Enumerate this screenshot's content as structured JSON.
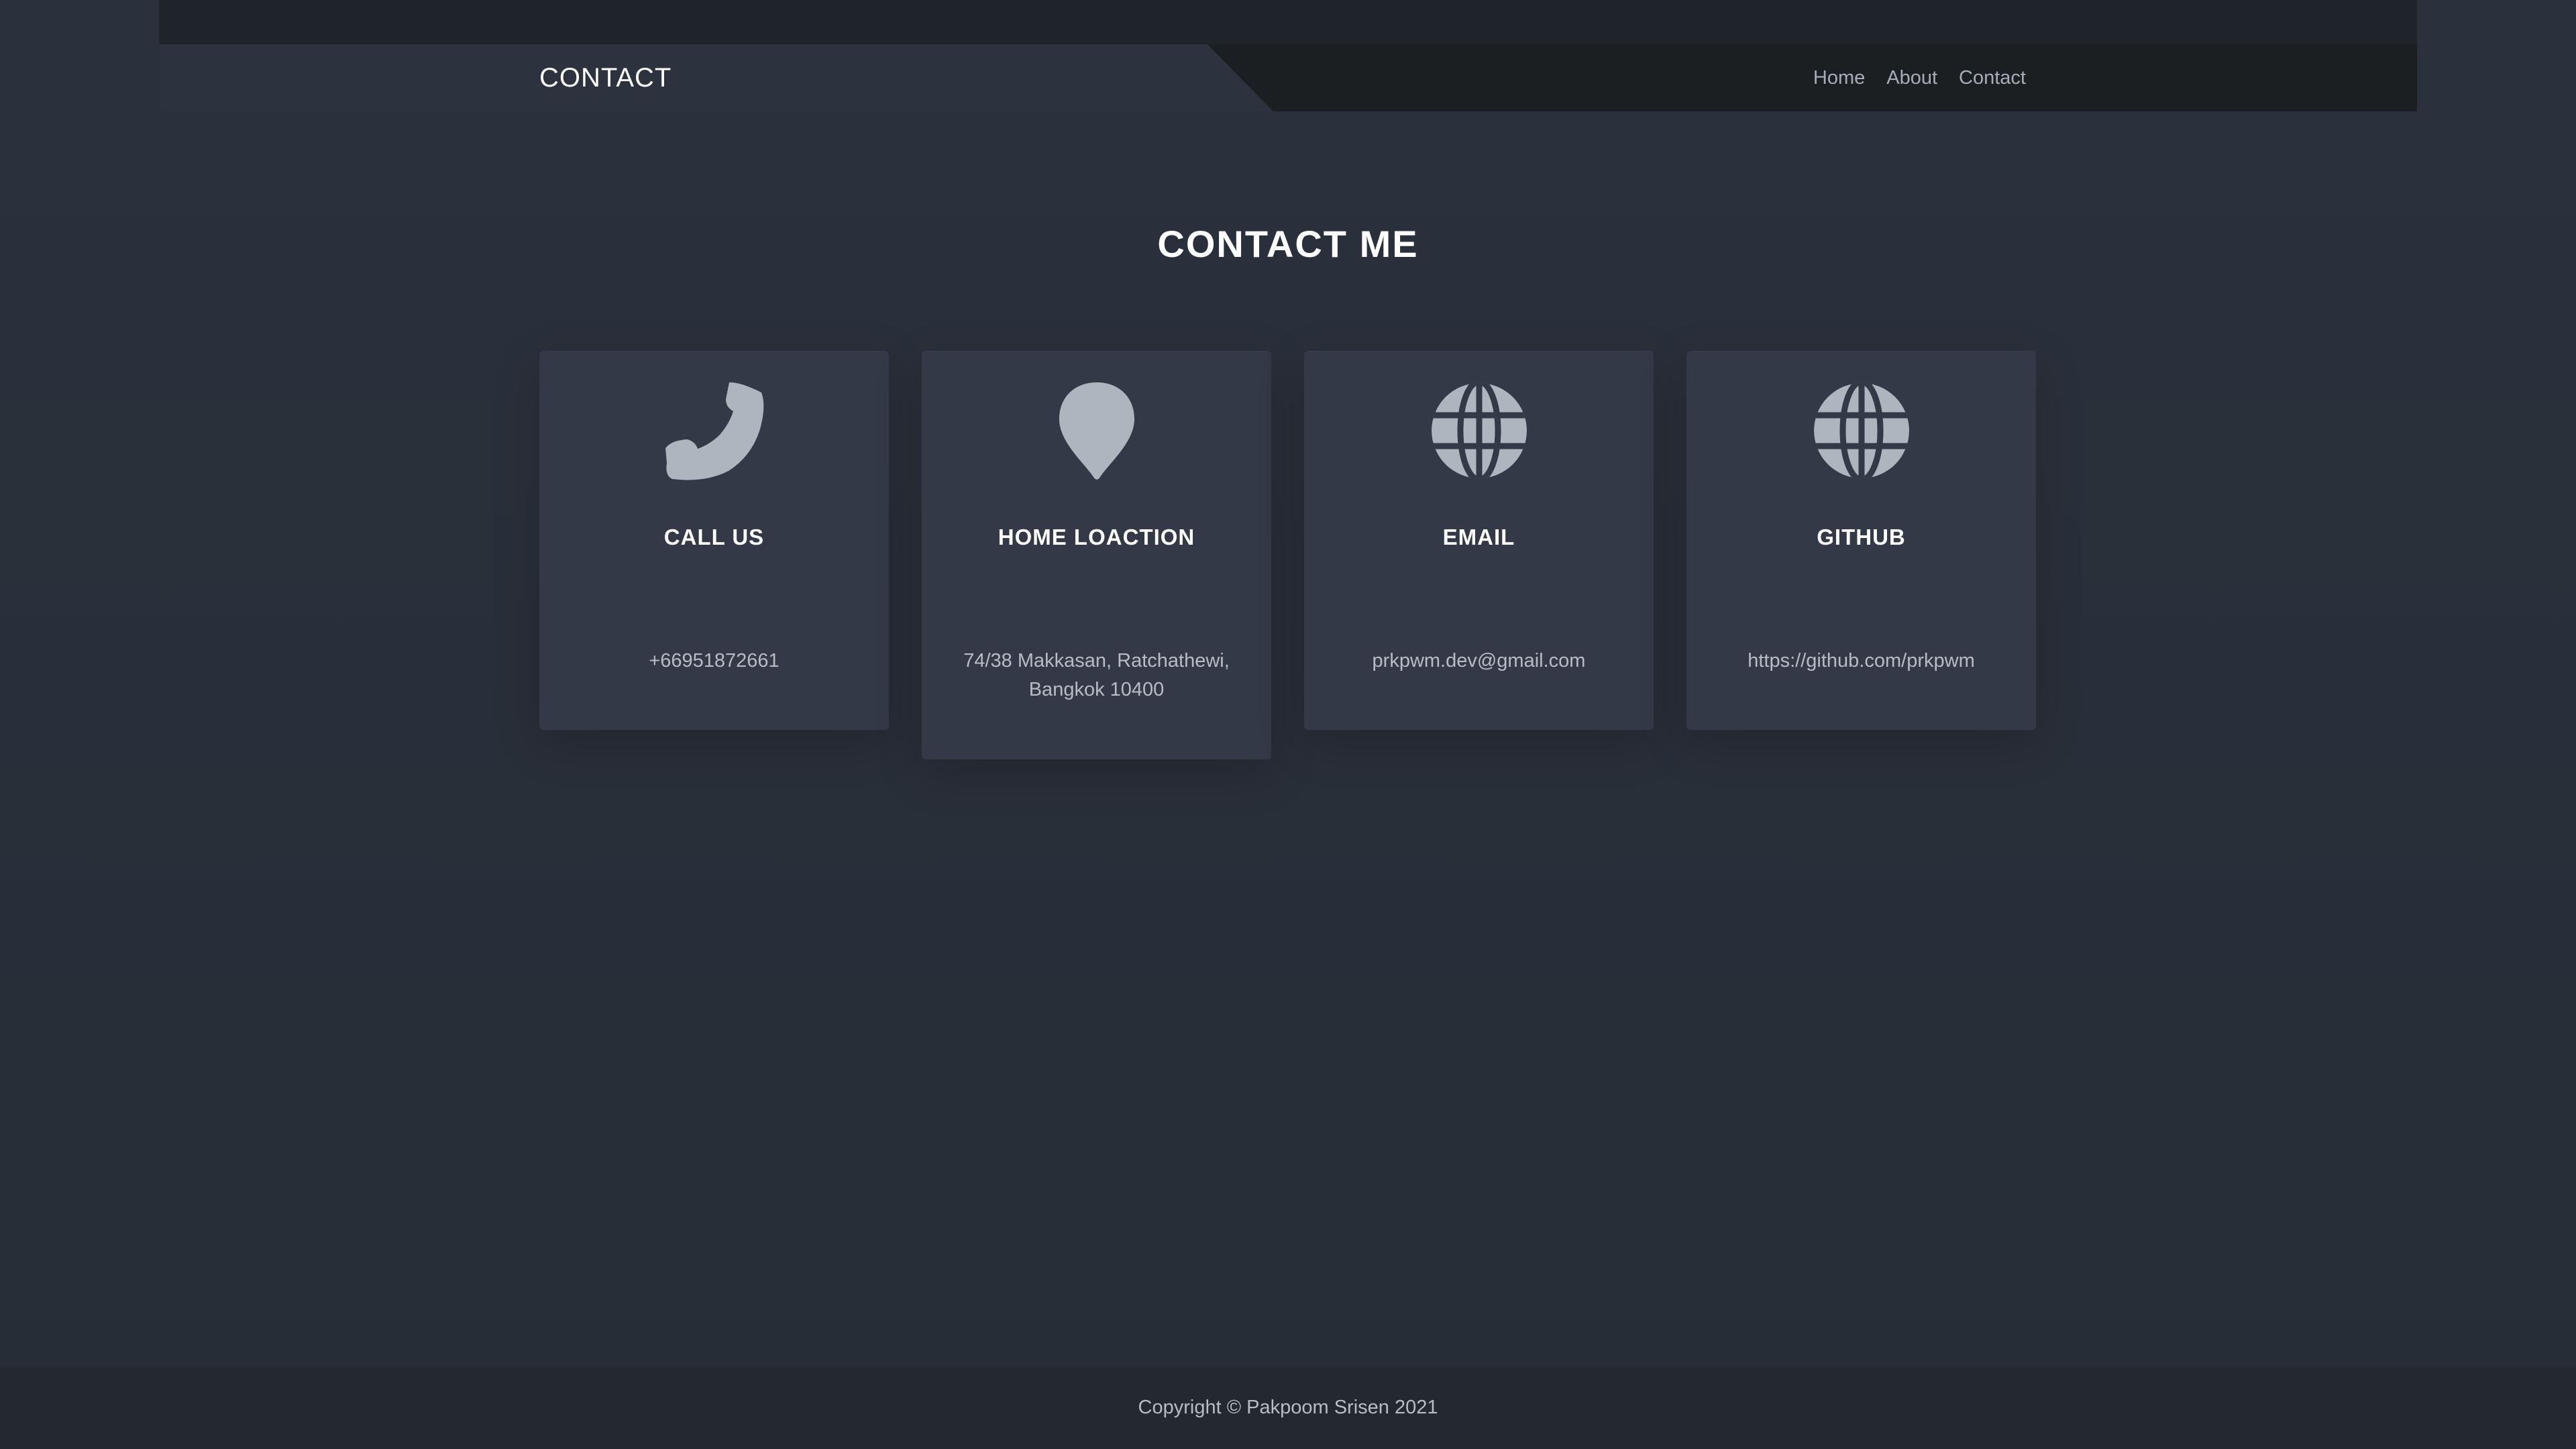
{
  "header": {
    "brand": "CONTACT",
    "nav": {
      "home": "Home",
      "about": "About",
      "contact": "Contact"
    }
  },
  "main": {
    "title": "CONTACT ME",
    "cards": [
      {
        "icon": "phone-icon",
        "title": "CALL US",
        "value": "+66951872661"
      },
      {
        "icon": "map-pin-icon",
        "title": "HOME LOACTION",
        "value": "74/38 Makkasan, Ratchathewi, Bangkok 10400"
      },
      {
        "icon": "globe-icon",
        "title": "EMAIL",
        "value": "prkpwm.dev@gmail.com"
      },
      {
        "icon": "globe-icon",
        "title": "GITHUB",
        "value": "https://github.com/prkpwm"
      }
    ]
  },
  "footer": {
    "copyright": "Copyright © Pakpoom Srisen 2021"
  },
  "colors": {
    "background": "#282e38",
    "card": "#333947",
    "topbar": "#1f242b",
    "nav_dark": "#1c1f22",
    "icon": "#aeb5bf",
    "text_muted": "#b7bcc5"
  }
}
